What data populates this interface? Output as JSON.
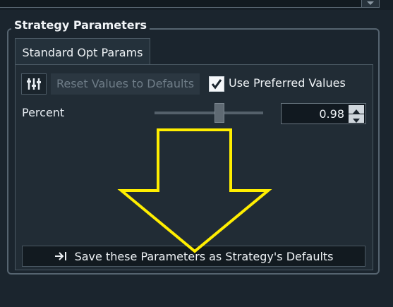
{
  "group": {
    "title": "Strategy Parameters"
  },
  "tab": {
    "label": "Standard Opt Params"
  },
  "toolbar": {
    "reset_label": "Reset Values to Defaults",
    "use_preferred_label": "Use Preferred Values",
    "use_preferred_checked": true
  },
  "param": {
    "label": "Percent",
    "value": "0.98",
    "slider_position": 0.6
  },
  "save": {
    "label": "Save these Parameters as Strategy's Defaults"
  },
  "colors": {
    "accent_arrow": "#ffee00",
    "background": "#1b252e"
  },
  "icons": [
    "chevron-down-icon",
    "sliders-icon",
    "checkmark-icon",
    "spin-up-icon",
    "spin-down-icon",
    "save-arrow-icon"
  ]
}
